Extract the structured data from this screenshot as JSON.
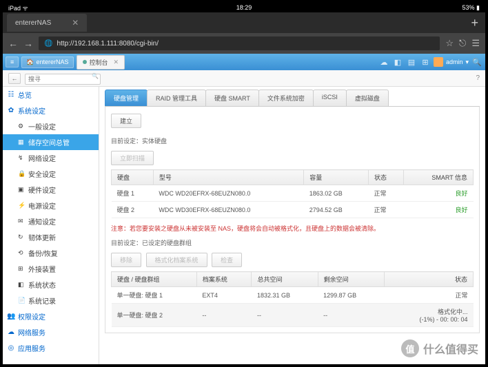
{
  "ios": {
    "left": "iPad ᯤ",
    "time": "18:29",
    "batt": "53% ▮"
  },
  "browser": {
    "tab": "entererNAS",
    "url": "http://192.168.1.111:8080/cgi-bin/"
  },
  "topbar": {
    "home": "entererNAS",
    "wtab": "控制台",
    "admin": "admin"
  },
  "search": {
    "placeholder": "搜寻"
  },
  "sidebar": {
    "cats": [
      {
        "icon": "☷",
        "label": "总览"
      },
      {
        "icon": "✿",
        "label": "系统设定"
      }
    ],
    "items": [
      {
        "icon": "⚙",
        "label": "一般设定"
      },
      {
        "icon": "▦",
        "label": "储存空间总管",
        "active": true
      },
      {
        "icon": "↯",
        "label": "网络设定"
      },
      {
        "icon": "🔒",
        "label": "安全设定"
      },
      {
        "icon": "▣",
        "label": "硬件设定"
      },
      {
        "icon": "⚡",
        "label": "电源设定"
      },
      {
        "icon": "✉",
        "label": "通知设定"
      },
      {
        "icon": "↻",
        "label": "韧体更新"
      },
      {
        "icon": "⟲",
        "label": "备份/恢复"
      },
      {
        "icon": "⊞",
        "label": "外接装置"
      },
      {
        "icon": "◧",
        "label": "系统状态"
      },
      {
        "icon": "📄",
        "label": "系统记录"
      }
    ],
    "cats2": [
      {
        "icon": "👥",
        "label": "权限设定"
      },
      {
        "icon": "☁",
        "label": "网络服务"
      },
      {
        "icon": "◎",
        "label": "应用服务"
      }
    ]
  },
  "tabs": [
    "硬盘管理",
    "RAID 管理工具",
    "硬盘 SMART",
    "文件系统加密",
    "iSCSI",
    "虚拟磁盘"
  ],
  "panel": {
    "build": "建立",
    "lbl1": "目前设定：实体硬盘",
    "scan": "立即扫描",
    "th1": [
      "硬盘",
      "型号",
      "容量",
      "状态",
      "SMART 信息"
    ],
    "disks": [
      {
        "n": "硬盘 1",
        "m": "WDC WD20EFRX-68EUZN080.0",
        "c": "1863.02 GB",
        "s": "正常",
        "sm": "良好"
      },
      {
        "n": "硬盘 2",
        "m": "WDC WD30EFRX-68EUZN080.0",
        "c": "2794.52 GB",
        "s": "正常",
        "sm": "良好"
      }
    ],
    "note": "注意：若您要安装之硬盘从未被安装至 NAS，硬盘将会自动被格式化，且硬盘上的数据会被清除。",
    "lbl2": "目前设定：已设定的硬盘群组",
    "btns": [
      "移除",
      "格式化档案系统",
      "检查"
    ],
    "th2": [
      "硬盘 / 硬盘群组",
      "档案系统",
      "总共空间",
      "剩余空间",
      "状态"
    ],
    "groups": [
      {
        "n": "单一硬盘: 硬盘 1",
        "fs": "EXT4",
        "t": "1832.31 GB",
        "f": "1299.87 GB",
        "s": "正常"
      },
      {
        "n": "单一硬盘: 硬盘 2",
        "fs": "--",
        "t": "--",
        "f": "--",
        "s": "格式化中...\n(-1%) - 00: 00: 04"
      }
    ]
  },
  "watermark": {
    "ch": "值",
    "text": "什么值得买"
  }
}
